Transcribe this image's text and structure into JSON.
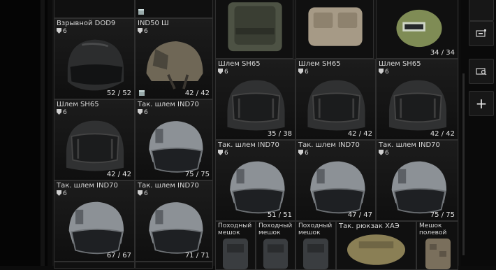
{
  "colors": {
    "background": "#0c0c0c",
    "cell_border": "#2f2f2f",
    "text": "#d6d6d6"
  },
  "stash_items": [
    {
      "name": "Взрывной DOD9",
      "armor": "6",
      "durability": "52 / 52",
      "found_in_raid": false,
      "icon": "helmet-dark-visor-icon"
    },
    {
      "name": "IND50 Ш",
      "armor": "6",
      "durability": "42 / 42",
      "found_in_raid": true,
      "icon": "helmet-tan-icon"
    },
    {
      "name": "Шлем SH65",
      "armor": "6",
      "durability": "35 / 38",
      "found_in_raid": false,
      "icon": "helmet-sh65-icon"
    },
    {
      "name": "Шлем SH65",
      "armor": "6",
      "durability": "42 / 42",
      "found_in_raid": false,
      "icon": "helmet-sh65-icon"
    },
    {
      "name": "Шлем SH65",
      "armor": "6",
      "durability": "42 / 42",
      "found_in_raid": false,
      "icon": "helmet-sh65-icon"
    },
    {
      "name": "Шлем SH65",
      "armor": "6",
      "durability": "42 / 42",
      "found_in_raid": false,
      "icon": "helmet-sh65-icon"
    },
    {
      "name": "Так. шлем IND70",
      "armor": "6",
      "durability": "75 / 75",
      "found_in_raid": false,
      "icon": "helmet-ind70-icon"
    },
    {
      "name": "Так. шлем IND70",
      "armor": "6",
      "durability": "51 / 51",
      "found_in_raid": false,
      "icon": "helmet-ind70-icon"
    },
    {
      "name": "Так. шлем IND70",
      "armor": "6",
      "durability": "47 / 47",
      "found_in_raid": false,
      "icon": "helmet-ind70-icon"
    },
    {
      "name": "Так. шлем IND70",
      "armor": "6",
      "durability": "75 / 75",
      "found_in_raid": false,
      "icon": "helmet-ind70-icon"
    },
    {
      "name": "Так. шлем IND70",
      "armor": "6",
      "durability": "67 / 67",
      "found_in_raid": false,
      "icon": "helmet-ind70-icon"
    },
    {
      "name": "Так. шлем IND70",
      "armor": "6",
      "durability": "71 / 71",
      "found_in_raid": false,
      "icon": "helmet-ind70-icon"
    },
    {
      "name": "",
      "armor": "",
      "durability": "34 / 34",
      "found_in_raid": false,
      "icon": "helmet-green-visor-icon"
    }
  ],
  "bottom_items": [
    {
      "name": "Походный мешок",
      "icon": "backpack-icon"
    },
    {
      "name": "Походный мешок",
      "icon": "backpack-icon"
    },
    {
      "name": "Походный мешок",
      "icon": "backpack-icon"
    },
    {
      "name": "Так. рюкзак ХАЭ",
      "icon": "backpack-tan-icon"
    },
    {
      "name": "Мешок полевой",
      "icon": "backpack-camo-icon"
    }
  ],
  "right_panel": {
    "add_label": "+"
  }
}
